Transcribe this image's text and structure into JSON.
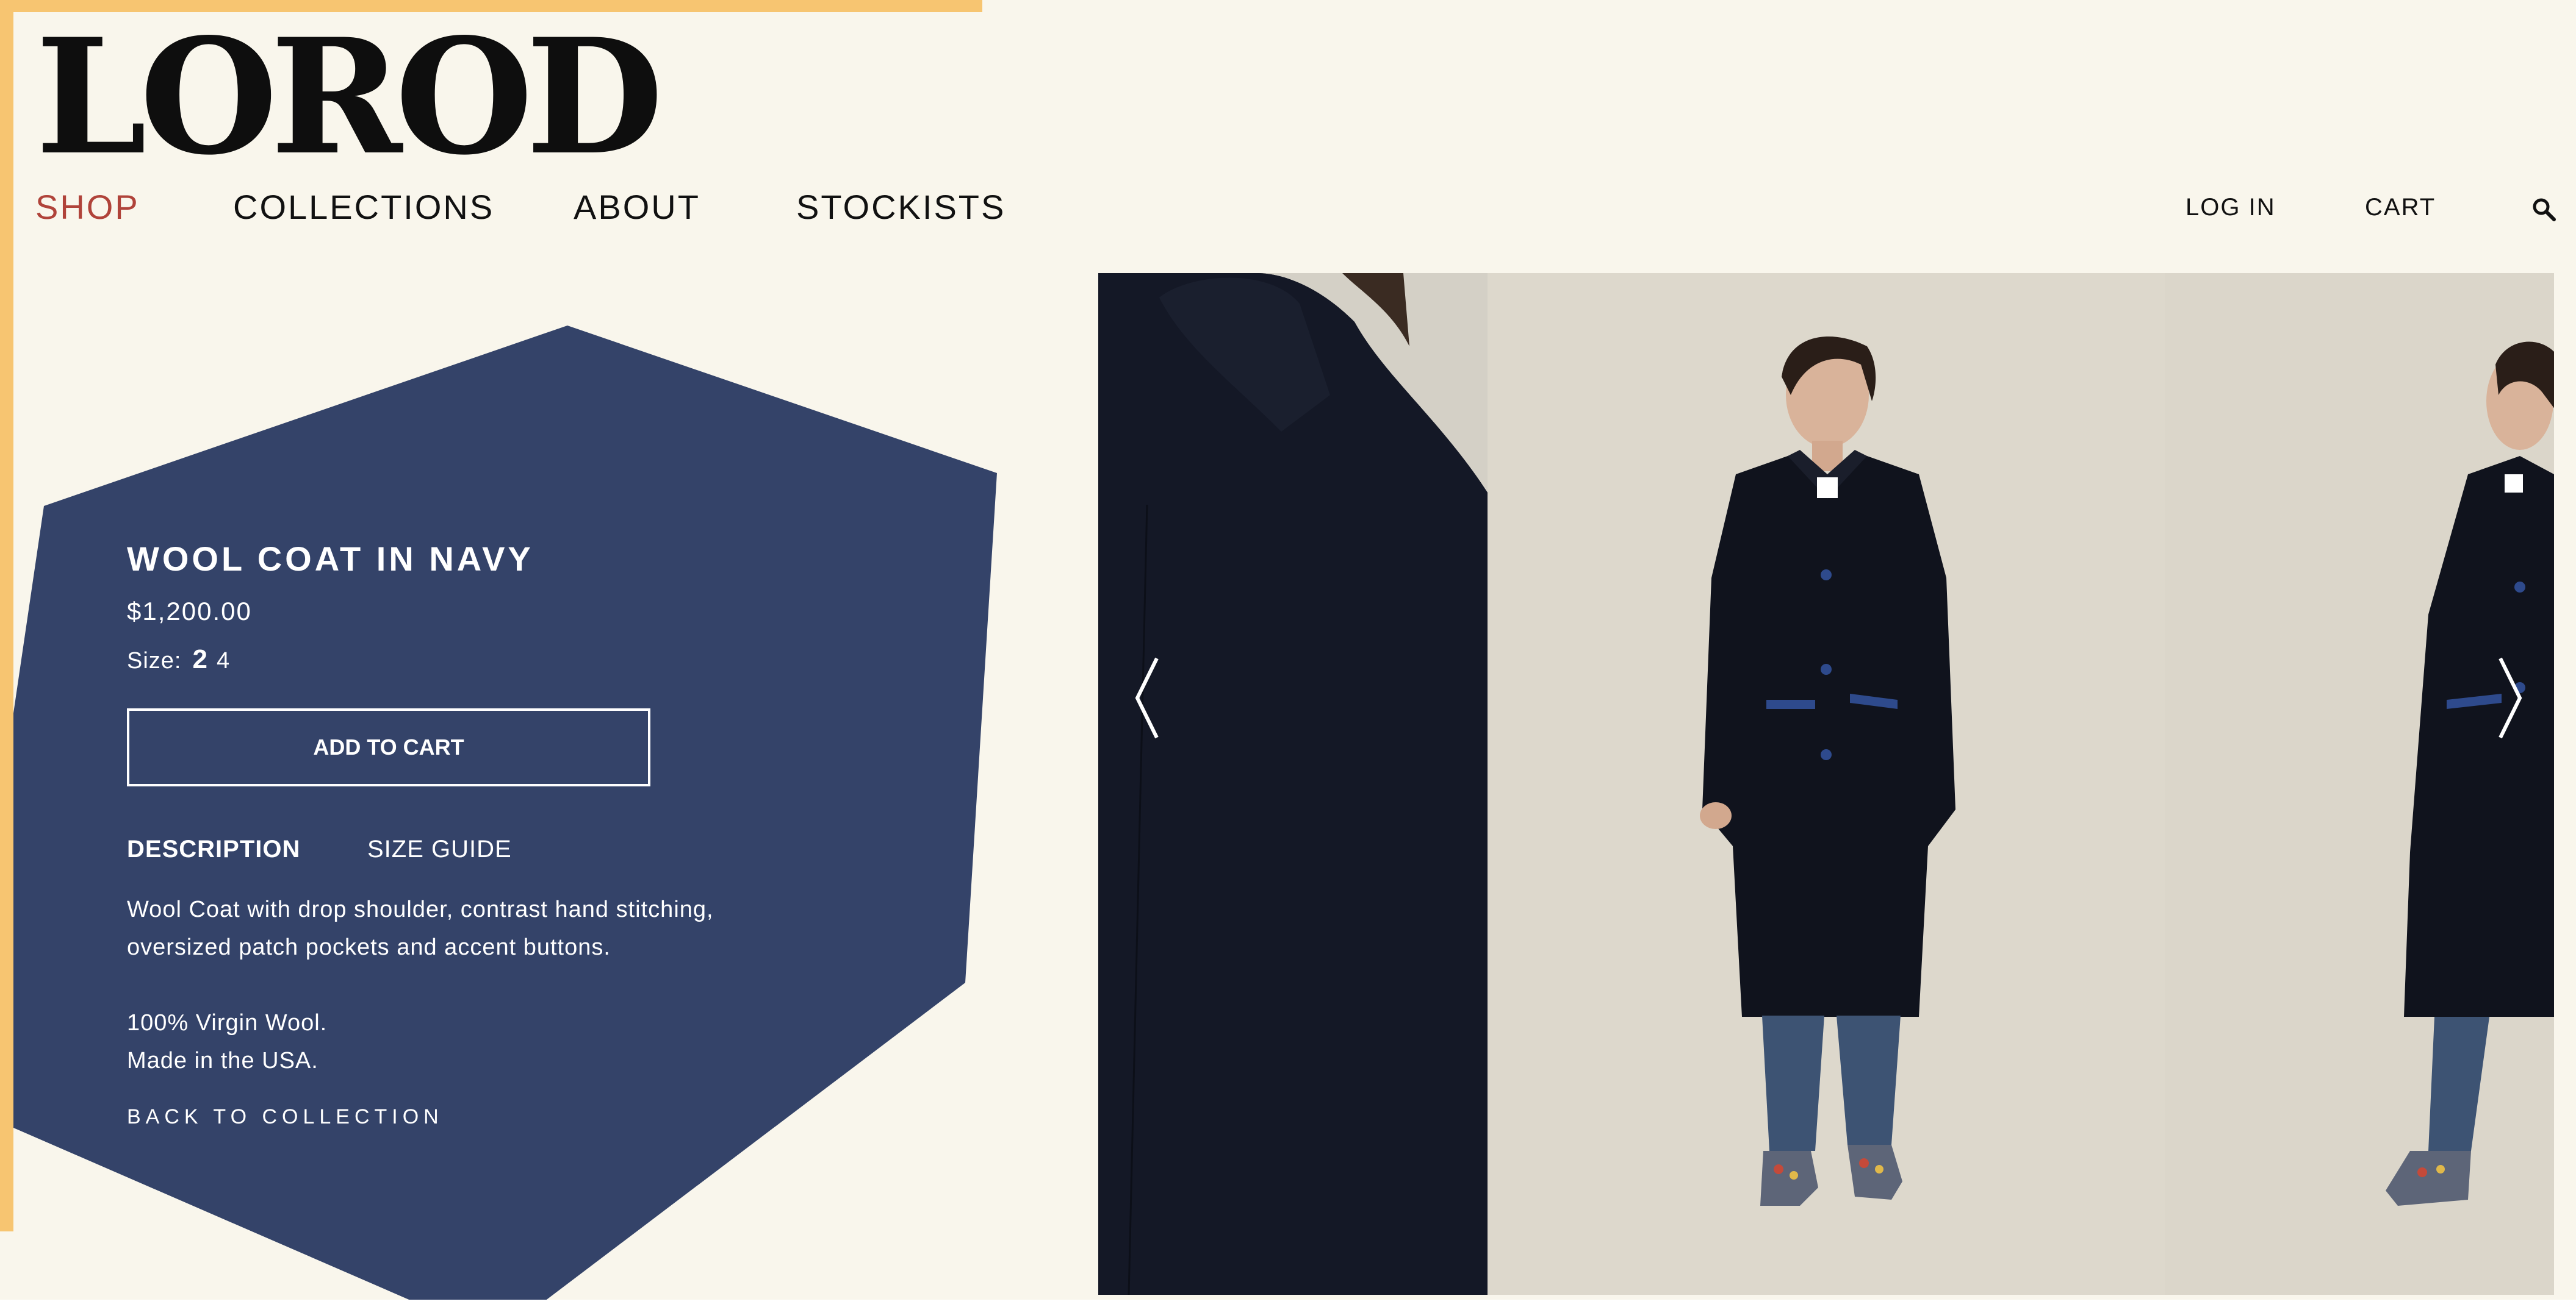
{
  "brand": {
    "logo_text": "LOROD"
  },
  "nav": {
    "shop": "SHOP",
    "collections": "COLLECTIONS",
    "about": "ABOUT",
    "stockists": "STOCKISTS",
    "active": "shop"
  },
  "utility": {
    "login": "LOG IN",
    "cart": "CART",
    "search_icon": "search-icon"
  },
  "product": {
    "title": "WOOL COAT IN NAVY",
    "price": "$1,200.00",
    "size_label": "Size:",
    "sizes": [
      "2",
      "4"
    ],
    "selected_size": "2",
    "add_to_cart": "ADD TO CART",
    "tabs": {
      "description": "DESCRIPTION",
      "size_guide": "SIZE GUIDE"
    },
    "description_lines": [
      "Wool Coat with drop shoulder, contrast hand stitching,",
      "oversized patch pockets and accent buttons.",
      "100% Virgin Wool.",
      "Made in the USA."
    ],
    "back_link": "BACK TO COLLECTION"
  },
  "gallery": {
    "prev_icon": "chevron-left-icon",
    "next_icon": "chevron-right-icon"
  },
  "colors": {
    "background": "#f9f6ec",
    "panel": "#344369",
    "accent_nav": "#b0433a",
    "frame": "#f7c571",
    "coat": "#111521"
  }
}
